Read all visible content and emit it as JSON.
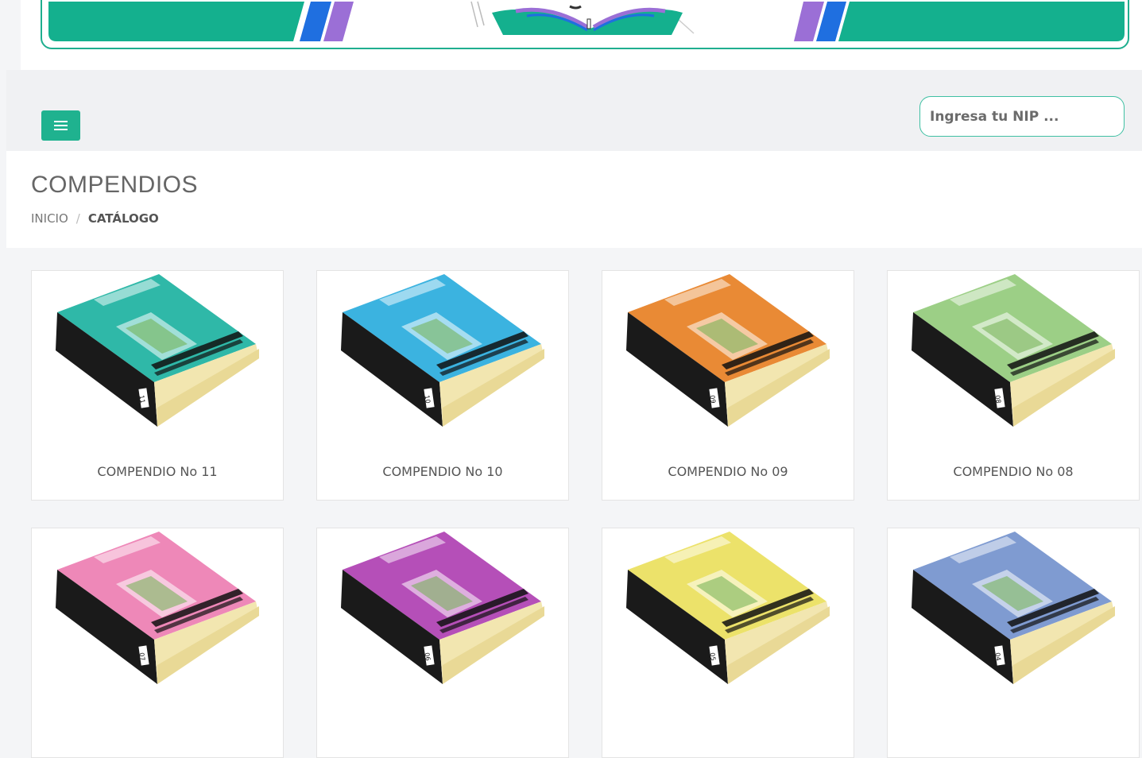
{
  "header": {
    "menu_button_label": "",
    "nip_placeholder": "Ingresa tu NIP ..."
  },
  "page": {
    "title": "COMPENDIOS",
    "breadcrumb": {
      "home": "INICIO",
      "separator": "/",
      "current": "CATÁLOGO"
    }
  },
  "colors": {
    "accent": "#1fb28f",
    "banner_purple": "#9b6fd6",
    "banner_blue": "#1f6fe0"
  },
  "catalog": {
    "items": [
      {
        "label": "COMPENDIO No 11",
        "cover_color": "#2fb8a8",
        "spine_number": "11"
      },
      {
        "label": "COMPENDIO No 10",
        "cover_color": "#3bb3e0",
        "spine_number": "10"
      },
      {
        "label": "COMPENDIO No 09",
        "cover_color": "#e98a35",
        "spine_number": "09"
      },
      {
        "label": "COMPENDIO No 08",
        "cover_color": "#9ccf86",
        "spine_number": "08"
      },
      {
        "label": "",
        "cover_color": "#ee88b8",
        "spine_number": "07"
      },
      {
        "label": "",
        "cover_color": "#b54fb8",
        "spine_number": "06"
      },
      {
        "label": "",
        "cover_color": "#ece26a",
        "spine_number": "05"
      },
      {
        "label": "",
        "cover_color": "#7f9bd1",
        "spine_number": "04"
      }
    ]
  }
}
